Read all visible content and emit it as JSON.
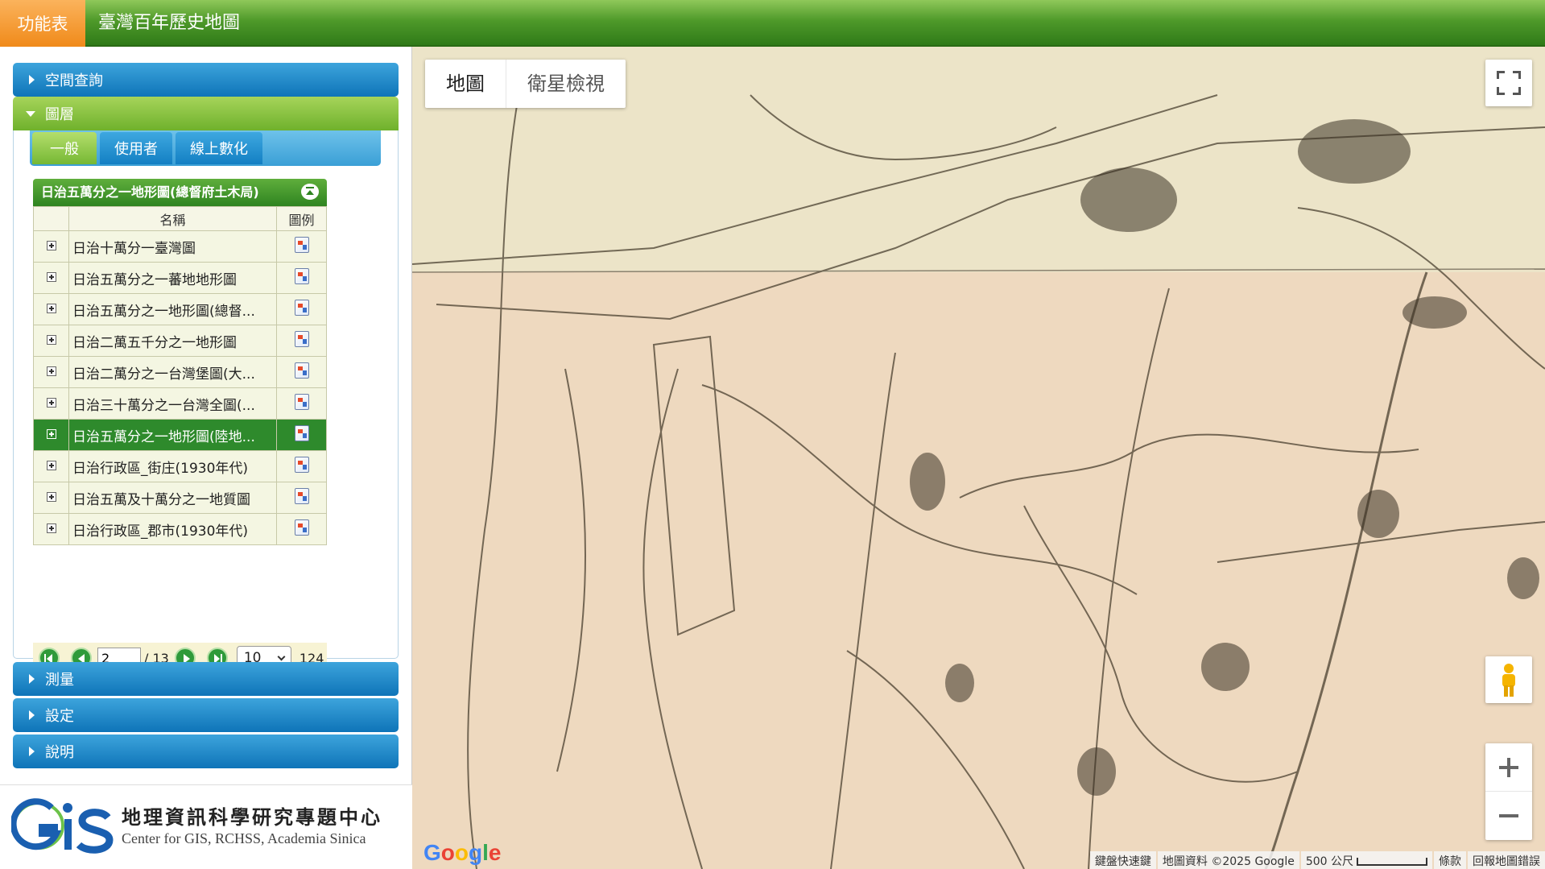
{
  "header": {
    "menu_label": "功能表",
    "app_title": "臺灣百年歷史地圖"
  },
  "sidebar": {
    "accordion": [
      {
        "label": "空間查詢",
        "state": "collapsed"
      },
      {
        "label": "圖層",
        "state": "expanded"
      },
      {
        "label": "測量",
        "state": "collapsed"
      },
      {
        "label": "設定",
        "state": "collapsed"
      },
      {
        "label": "說明",
        "state": "collapsed"
      }
    ],
    "layer_tabs": [
      {
        "label": "一般",
        "active": true
      },
      {
        "label": "使用者",
        "active": false
      },
      {
        "label": "線上數化",
        "active": false
      }
    ],
    "group_title": "日治五萬分之一地形圖(總督府土木局)",
    "table_headers": {
      "name": "名稱",
      "legend": "圖例"
    },
    "layers": [
      {
        "name": "日治十萬分一臺灣圖",
        "selected": false
      },
      {
        "name": "日治五萬分之一蕃地地形圖",
        "selected": false
      },
      {
        "name": "日治五萬分之一地形圖(總督...",
        "selected": false
      },
      {
        "name": "日治二萬五千分之一地形圖",
        "selected": false
      },
      {
        "name": "日治二萬分之一台灣堡圖(大...",
        "selected": false
      },
      {
        "name": "日治三十萬分之一台灣全圖(...",
        "selected": false
      },
      {
        "name": "日治五萬分之一地形圖(陸地...",
        "selected": true
      },
      {
        "name": "日治行政區_街庄(1930年代)",
        "selected": false
      },
      {
        "name": "日治五萬及十萬分之一地質圖",
        "selected": false
      },
      {
        "name": "日治行政區_郡市(1930年代)",
        "selected": false
      }
    ],
    "pager": {
      "current_page": "2",
      "total_pages": "/ 13",
      "page_size": "10",
      "total_count": "124"
    }
  },
  "logo": {
    "title_cn": "地理資訊科學研究專題中心",
    "title_en": "Center for GIS, RCHSS, Academia Sinica"
  },
  "map": {
    "map_type_options": [
      "地圖",
      "衛星檢視"
    ],
    "selected_map_type": "地圖",
    "google_logo": "Google",
    "footer": {
      "shortcuts": "鍵盤快速鍵",
      "attribution": "地圖資料 ©2025 Google",
      "scale": "500 公尺",
      "terms": "條款",
      "report": "回報地圖錯誤"
    }
  },
  "colors": {
    "topbar_green": "#4f9a2a",
    "menu_orange": "#f08a1a",
    "accordion_blue": "#0e74b8",
    "selected_row": "#2e8a2c"
  }
}
